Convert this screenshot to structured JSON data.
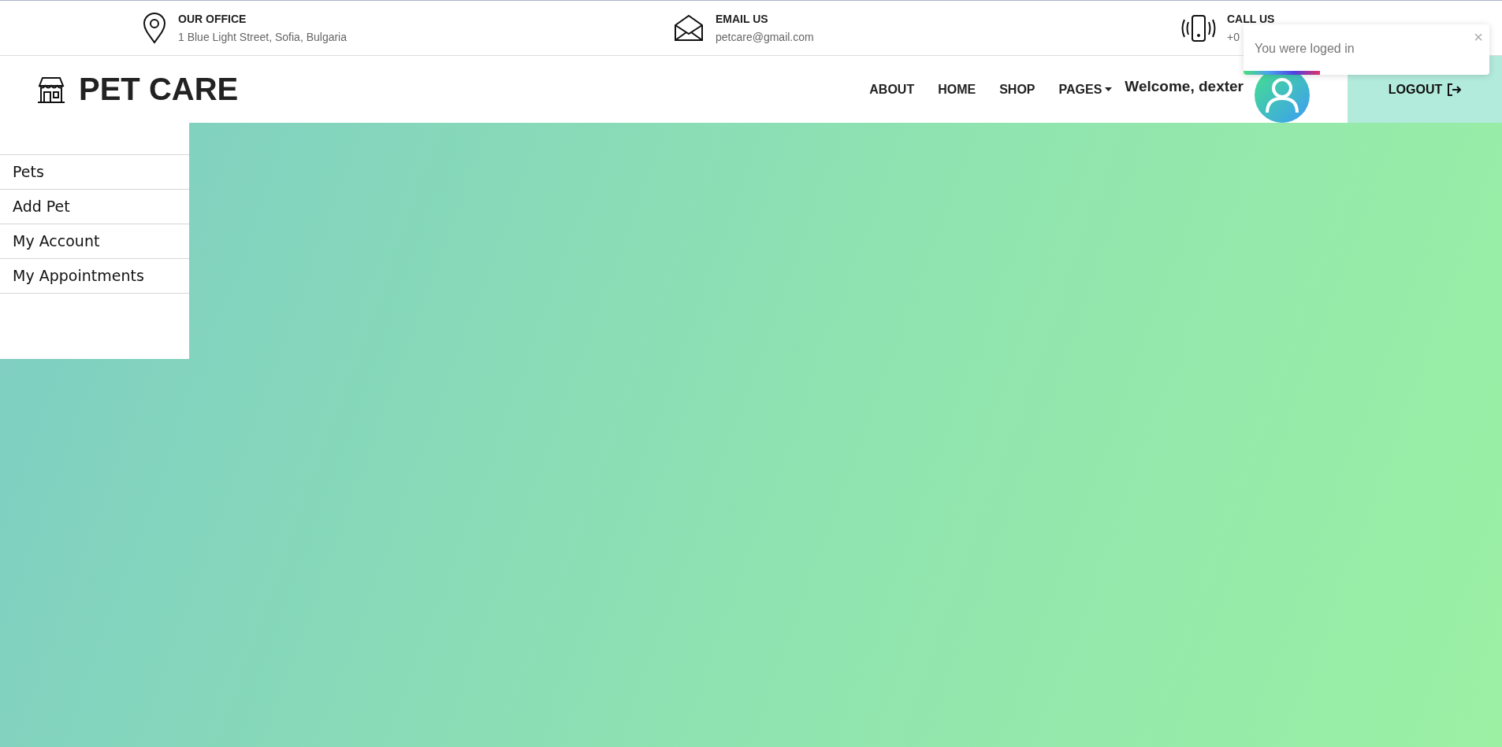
{
  "contact_bar": [
    {
      "kind": "location",
      "title": "OUR OFFICE",
      "detail": "1 Blue Light Street, Sofia, Bulgaria"
    },
    {
      "kind": "email",
      "title": "EMAIL US",
      "detail": "petcare@gmail.com"
    },
    {
      "kind": "phone",
      "title": "CALL US",
      "detail": "+0"
    }
  ],
  "toast": {
    "message": "You were loged in",
    "close": "×",
    "level": 0.31
  },
  "navbar": {
    "brand": "PET CARE",
    "links": [
      {
        "label": "ABOUT",
        "dropdown": false
      },
      {
        "label": "HOME",
        "dropdown": false
      },
      {
        "label": "SHOP",
        "dropdown": false
      },
      {
        "label": "PAGES",
        "dropdown": true
      }
    ],
    "welcome": "Welcome, dexter",
    "logout": "LOGOUT"
  },
  "sidebar": {
    "items": [
      "Pets",
      "Add Pet",
      "My Account",
      "My Appointments"
    ]
  }
}
